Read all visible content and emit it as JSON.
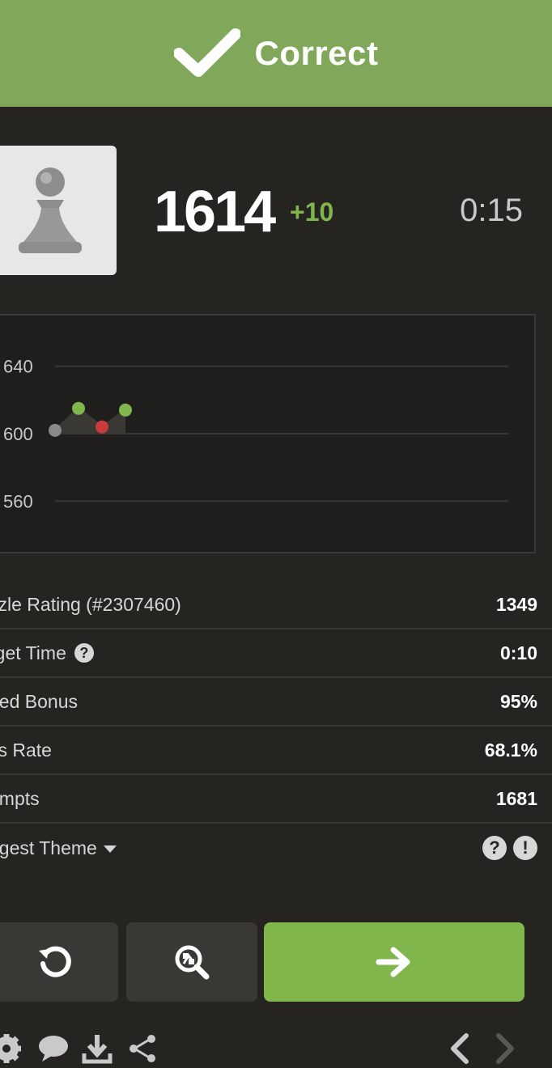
{
  "banner": {
    "label": "Correct",
    "color": "#81a85a",
    "icon": "check-icon"
  },
  "header": {
    "avatar_icon": "pawn-icon",
    "rating": "1614",
    "rating_change": "+10",
    "timer": "0:15"
  },
  "chart_data": {
    "type": "line",
    "tick_labels": [
      "640",
      "600",
      "560"
    ],
    "x": [
      1,
      2,
      3,
      4
    ],
    "values": [
      1602,
      1615,
      1604,
      1614
    ],
    "point_colors": [
      "#8b8987",
      "#81b64c",
      "#c93a3a",
      "#81b64c"
    ],
    "ylim": [
      1530,
      1670
    ],
    "grid": true
  },
  "stats": [
    {
      "label": "zzle Rating (#2307460)",
      "value": "1349",
      "help": false
    },
    {
      "label": "rget Time",
      "value": "0:10",
      "help": true
    },
    {
      "label": "eed Bonus",
      "value": "95%",
      "help": false
    },
    {
      "label": "ss Rate",
      "value": "68.1%",
      "help": false
    },
    {
      "label": "empts",
      "value": "1681",
      "help": false
    },
    {
      "label": "ggest Theme",
      "value": "",
      "help": false
    }
  ],
  "actions": {
    "retry_icon": "retry-icon",
    "analyze_icon": "analysis-icon",
    "next_icon": "arrow-right-icon"
  },
  "toolbar": [
    "gear-icon",
    "chat-icon",
    "download-icon",
    "share-icon",
    "chevron-left-icon",
    "chevron-right-icon"
  ],
  "colors": {
    "background": "#262421",
    "accent_green": "#81b64c",
    "fail_red": "#c93a3a"
  }
}
